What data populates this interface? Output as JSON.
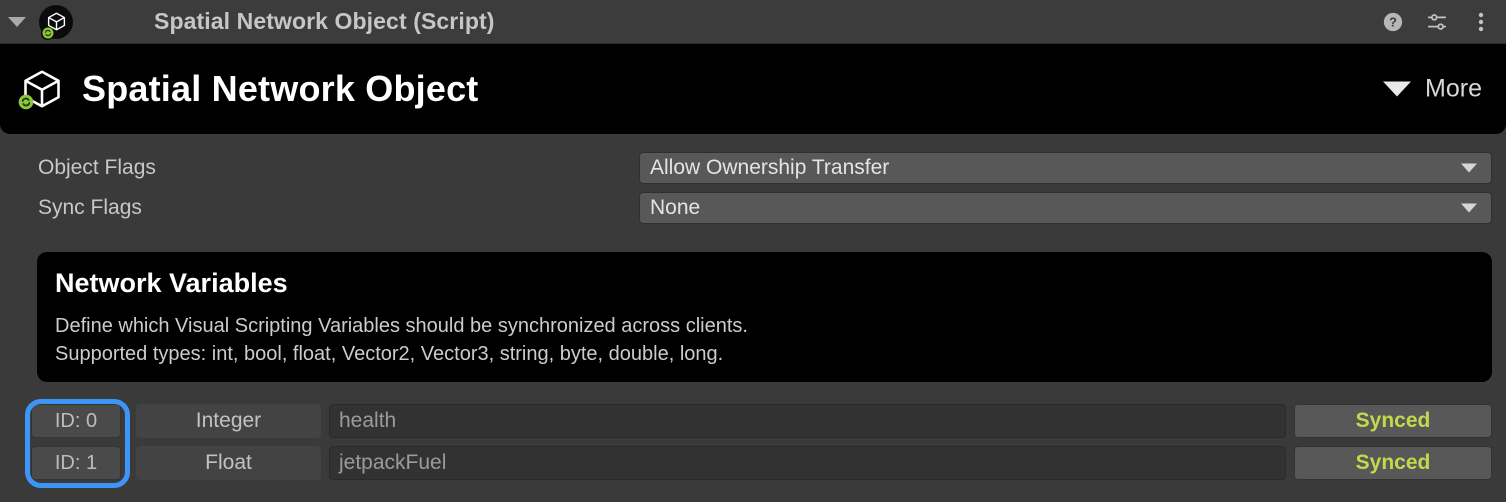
{
  "component_header": {
    "title": "Spatial Network Object (Script)",
    "foldout_icon": "triangle-down-icon",
    "component_icon": "cube-icon",
    "sync_badge_icon": "sync-badge-icon",
    "tools": [
      {
        "name": "help-icon",
        "glyph": "?"
      },
      {
        "name": "preset-icon",
        "glyph": "sliders"
      },
      {
        "name": "more-menu-icon",
        "glyph": "kebab"
      }
    ]
  },
  "title_band": {
    "title": "Spatial Network Object",
    "icon": "cube-icon",
    "badge_icon": "sync-badge-icon",
    "more_label": "More",
    "more_icon": "triangle-down-icon"
  },
  "properties": [
    {
      "label": "Object Flags",
      "value": "Allow Ownership Transfer",
      "arrow": "chevron-down-icon"
    },
    {
      "label": "Sync Flags",
      "value": "None",
      "arrow": "chevron-down-icon"
    }
  ],
  "network_variables": {
    "title": "Network Variables",
    "description_line1": "Define which Visual Scripting Variables should be synchronized across clients.",
    "description_line2": "Supported types: int, bool, float, Vector2, Vector3, string, byte, double, long.",
    "rows": [
      {
        "id": "ID: 0",
        "type": "Integer",
        "name": "health",
        "status": "Synced"
      },
      {
        "id": "ID: 1",
        "type": "Float",
        "name": "jetpackFuel",
        "status": "Synced"
      }
    ]
  },
  "colors": {
    "background": "#3a3a3a",
    "panel_black": "#000000",
    "header_bar": "#3c3c3c",
    "dropdown": "#585858",
    "synced_green": "#c3d94b",
    "annotation_blue": "#3d96f7",
    "badge_green": "#8cc63f"
  }
}
